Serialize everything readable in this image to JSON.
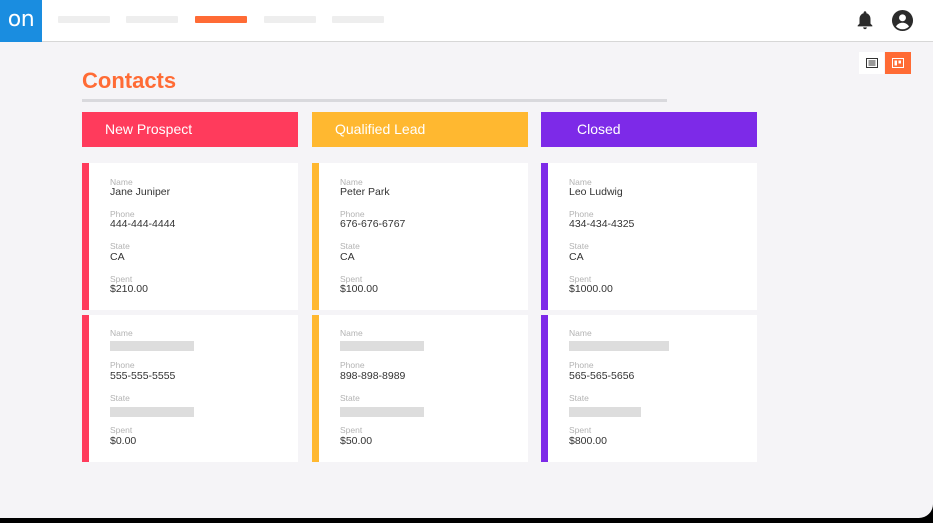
{
  "app": {
    "logo_text": "on",
    "brand_color": "#1a8de0",
    "accent_color": "#ff6b35",
    "nav_tabs": [
      {
        "active": false
      },
      {
        "active": false
      },
      {
        "active": true
      },
      {
        "active": false
      },
      {
        "active": false
      }
    ],
    "icons": {
      "notifications": "bell-icon",
      "account": "account-circle-icon",
      "list_view": "list-view-icon",
      "board_view": "board-view-icon"
    }
  },
  "page": {
    "title": "Contacts"
  },
  "columns": [
    {
      "title": "New Prospect",
      "color": "#ff3b5c",
      "cards": [
        {
          "name_label": "Name",
          "name": "Jane Juniper",
          "phone_label": "Phone",
          "phone": "444-444-4444",
          "state_label": "State",
          "state": "CA",
          "spent_label": "Spent",
          "spent": "$210.00"
        },
        {
          "name_label": "Name",
          "name": "",
          "phone_label": "Phone",
          "phone": "555-555-5555",
          "state_label": "State",
          "state": "",
          "spent_label": "Spent",
          "spent": "$0.00"
        }
      ]
    },
    {
      "title": "Qualified Lead",
      "color": "#ffb830",
      "cards": [
        {
          "name_label": "Name",
          "name": "Peter Park",
          "phone_label": "Phone",
          "phone": "676-676-6767",
          "state_label": "State",
          "state": "CA",
          "spent_label": "Spent",
          "spent": "$100.00"
        },
        {
          "name_label": "Name",
          "name": "",
          "phone_label": "Phone",
          "phone": "898-898-8989",
          "state_label": "State",
          "state": "",
          "spent_label": "Spent",
          "spent": "$50.00"
        }
      ]
    },
    {
      "title": "Closed",
      "color": "#7d2ae8",
      "cards": [
        {
          "name_label": "Name",
          "name": "Leo Ludwig",
          "phone_label": "Phone",
          "phone": "434-434-4325",
          "state_label": "State",
          "state": "CA",
          "spent_label": "Spent",
          "spent": "$1000.00"
        },
        {
          "name_label": "Name",
          "name": "",
          "phone_label": "Phone",
          "phone": "565-565-5656",
          "state_label": "State",
          "state": "",
          "spent_label": "Spent",
          "spent": "$800.00"
        }
      ]
    }
  ]
}
